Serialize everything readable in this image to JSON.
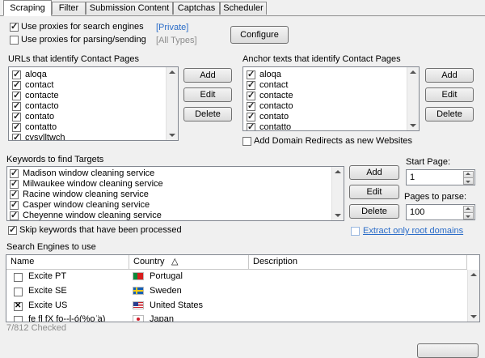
{
  "tabs": [
    "Scraping",
    "Filter",
    "Submission Content",
    "Captchas",
    "Scheduler"
  ],
  "proxies": {
    "search_label": "Use proxies for search engines",
    "search_value": "[Private]",
    "parsing_label": "Use proxies for parsing/sending",
    "parsing_value": "[All Types]",
    "configure_label": "Configure"
  },
  "urls_section": {
    "title": "URLs that identify Contact Pages",
    "items": [
      "aloqa",
      "contact",
      "contacte",
      "contacto",
      "contato",
      "contatto",
      "cysylltwch"
    ],
    "add": "Add",
    "edit": "Edit",
    "delete": "Delete"
  },
  "anchors_section": {
    "title": "Anchor texts that identify Contact Pages",
    "items": [
      "aloqa",
      "contact",
      "contacte",
      "contacto",
      "contato",
      "contatto"
    ],
    "add": "Add",
    "edit": "Edit",
    "delete": "Delete",
    "redirects_label": "Add Domain Redirects as new Websites"
  },
  "keywords_section": {
    "title": "Keywords to find Targets",
    "items": [
      "Madison window cleaning service",
      "Milwaukee window cleaning service",
      "Racine window cleaning service",
      "Casper window cleaning service",
      "Cheyenne window cleaning service"
    ],
    "add": "Add",
    "edit": "Edit",
    "delete": "Delete",
    "skip_label": "Skip keywords that have been processed",
    "start_page_label": "Start Page:",
    "start_page_value": "1",
    "pages_label": "Pages to parse:",
    "pages_value": "100",
    "root_label": "Extract only root domains"
  },
  "engines": {
    "title": "Search Engines to use",
    "columns": [
      "Name",
      "Country",
      "Description"
    ],
    "sort_indicator": "△",
    "rows": [
      {
        "name": "Excite PT",
        "country": "Portugal",
        "checked": false
      },
      {
        "name": "Excite SE",
        "country": "Sweden",
        "checked": false
      },
      {
        "name": "Excite US",
        "country": "United States",
        "checked": true
      },
      {
        "name": "fe fl fX fo--l-ó(%o ̈a)",
        "country": "Japan",
        "checked": false
      }
    ],
    "status": "7/812 Checked"
  },
  "colors": {
    "link": "#2a6cc8",
    "grey": "#8c8c8c"
  }
}
